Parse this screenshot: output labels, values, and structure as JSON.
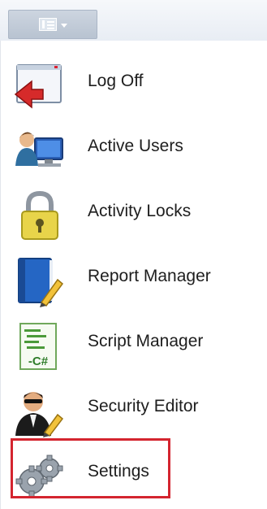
{
  "menu": {
    "items": [
      {
        "label": "Log Off",
        "icon": "logoff-icon"
      },
      {
        "label": "Active Users",
        "icon": "active-users-icon"
      },
      {
        "label": "Activity Locks",
        "icon": "padlock-icon"
      },
      {
        "label": "Report Manager",
        "icon": "report-book-icon"
      },
      {
        "label": "Script Manager",
        "icon": "script-csharp-icon"
      },
      {
        "label": "Security Editor",
        "icon": "security-agent-icon"
      },
      {
        "label": "Settings",
        "icon": "gears-icon"
      }
    ],
    "highlighted_item": "Settings",
    "highlight_color": "#d4252f"
  }
}
